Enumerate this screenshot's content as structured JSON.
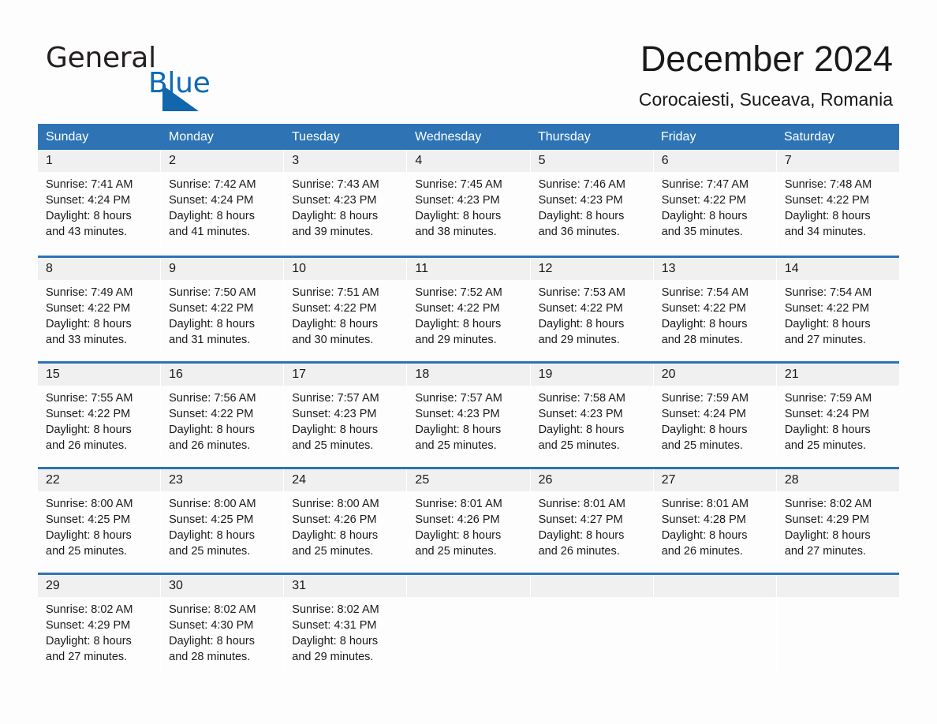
{
  "brand": {
    "word_one": "General",
    "word_two": "Blue",
    "logo_icon": "triangle-flag-icon"
  },
  "header": {
    "month_title": "December 2024",
    "location": "Corocaiesti, Suceava, Romania"
  },
  "colors": {
    "header_blue": "#2e74b5",
    "brand_blue": "#0d6ab5",
    "day_band_gray": "#f0f0f0",
    "page_bg": "#fdfdfd",
    "text": "#1a1a1a"
  },
  "calendar": {
    "weekday_headers": [
      "Sunday",
      "Monday",
      "Tuesday",
      "Wednesday",
      "Thursday",
      "Friday",
      "Saturday"
    ],
    "weeks": [
      [
        {
          "day": "1",
          "sunrise": "Sunrise: 7:41 AM",
          "sunset": "Sunset: 4:24 PM",
          "daylight_line1": "Daylight: 8 hours",
          "daylight_line2": "and 43 minutes."
        },
        {
          "day": "2",
          "sunrise": "Sunrise: 7:42 AM",
          "sunset": "Sunset: 4:24 PM",
          "daylight_line1": "Daylight: 8 hours",
          "daylight_line2": "and 41 minutes."
        },
        {
          "day": "3",
          "sunrise": "Sunrise: 7:43 AM",
          "sunset": "Sunset: 4:23 PM",
          "daylight_line1": "Daylight: 8 hours",
          "daylight_line2": "and 39 minutes."
        },
        {
          "day": "4",
          "sunrise": "Sunrise: 7:45 AM",
          "sunset": "Sunset: 4:23 PM",
          "daylight_line1": "Daylight: 8 hours",
          "daylight_line2": "and 38 minutes."
        },
        {
          "day": "5",
          "sunrise": "Sunrise: 7:46 AM",
          "sunset": "Sunset: 4:23 PM",
          "daylight_line1": "Daylight: 8 hours",
          "daylight_line2": "and 36 minutes."
        },
        {
          "day": "6",
          "sunrise": "Sunrise: 7:47 AM",
          "sunset": "Sunset: 4:22 PM",
          "daylight_line1": "Daylight: 8 hours",
          "daylight_line2": "and 35 minutes."
        },
        {
          "day": "7",
          "sunrise": "Sunrise: 7:48 AM",
          "sunset": "Sunset: 4:22 PM",
          "daylight_line1": "Daylight: 8 hours",
          "daylight_line2": "and 34 minutes."
        }
      ],
      [
        {
          "day": "8",
          "sunrise": "Sunrise: 7:49 AM",
          "sunset": "Sunset: 4:22 PM",
          "daylight_line1": "Daylight: 8 hours",
          "daylight_line2": "and 33 minutes."
        },
        {
          "day": "9",
          "sunrise": "Sunrise: 7:50 AM",
          "sunset": "Sunset: 4:22 PM",
          "daylight_line1": "Daylight: 8 hours",
          "daylight_line2": "and 31 minutes."
        },
        {
          "day": "10",
          "sunrise": "Sunrise: 7:51 AM",
          "sunset": "Sunset: 4:22 PM",
          "daylight_line1": "Daylight: 8 hours",
          "daylight_line2": "and 30 minutes."
        },
        {
          "day": "11",
          "sunrise": "Sunrise: 7:52 AM",
          "sunset": "Sunset: 4:22 PM",
          "daylight_line1": "Daylight: 8 hours",
          "daylight_line2": "and 29 minutes."
        },
        {
          "day": "12",
          "sunrise": "Sunrise: 7:53 AM",
          "sunset": "Sunset: 4:22 PM",
          "daylight_line1": "Daylight: 8 hours",
          "daylight_line2": "and 29 minutes."
        },
        {
          "day": "13",
          "sunrise": "Sunrise: 7:54 AM",
          "sunset": "Sunset: 4:22 PM",
          "daylight_line1": "Daylight: 8 hours",
          "daylight_line2": "and 28 minutes."
        },
        {
          "day": "14",
          "sunrise": "Sunrise: 7:54 AM",
          "sunset": "Sunset: 4:22 PM",
          "daylight_line1": "Daylight: 8 hours",
          "daylight_line2": "and 27 minutes."
        }
      ],
      [
        {
          "day": "15",
          "sunrise": "Sunrise: 7:55 AM",
          "sunset": "Sunset: 4:22 PM",
          "daylight_line1": "Daylight: 8 hours",
          "daylight_line2": "and 26 minutes."
        },
        {
          "day": "16",
          "sunrise": "Sunrise: 7:56 AM",
          "sunset": "Sunset: 4:22 PM",
          "daylight_line1": "Daylight: 8 hours",
          "daylight_line2": "and 26 minutes."
        },
        {
          "day": "17",
          "sunrise": "Sunrise: 7:57 AM",
          "sunset": "Sunset: 4:23 PM",
          "daylight_line1": "Daylight: 8 hours",
          "daylight_line2": "and 25 minutes."
        },
        {
          "day": "18",
          "sunrise": "Sunrise: 7:57 AM",
          "sunset": "Sunset: 4:23 PM",
          "daylight_line1": "Daylight: 8 hours",
          "daylight_line2": "and 25 minutes."
        },
        {
          "day": "19",
          "sunrise": "Sunrise: 7:58 AM",
          "sunset": "Sunset: 4:23 PM",
          "daylight_line1": "Daylight: 8 hours",
          "daylight_line2": "and 25 minutes."
        },
        {
          "day": "20",
          "sunrise": "Sunrise: 7:59 AM",
          "sunset": "Sunset: 4:24 PM",
          "daylight_line1": "Daylight: 8 hours",
          "daylight_line2": "and 25 minutes."
        },
        {
          "day": "21",
          "sunrise": "Sunrise: 7:59 AM",
          "sunset": "Sunset: 4:24 PM",
          "daylight_line1": "Daylight: 8 hours",
          "daylight_line2": "and 25 minutes."
        }
      ],
      [
        {
          "day": "22",
          "sunrise": "Sunrise: 8:00 AM",
          "sunset": "Sunset: 4:25 PM",
          "daylight_line1": "Daylight: 8 hours",
          "daylight_line2": "and 25 minutes."
        },
        {
          "day": "23",
          "sunrise": "Sunrise: 8:00 AM",
          "sunset": "Sunset: 4:25 PM",
          "daylight_line1": "Daylight: 8 hours",
          "daylight_line2": "and 25 minutes."
        },
        {
          "day": "24",
          "sunrise": "Sunrise: 8:00 AM",
          "sunset": "Sunset: 4:26 PM",
          "daylight_line1": "Daylight: 8 hours",
          "daylight_line2": "and 25 minutes."
        },
        {
          "day": "25",
          "sunrise": "Sunrise: 8:01 AM",
          "sunset": "Sunset: 4:26 PM",
          "daylight_line1": "Daylight: 8 hours",
          "daylight_line2": "and 25 minutes."
        },
        {
          "day": "26",
          "sunrise": "Sunrise: 8:01 AM",
          "sunset": "Sunset: 4:27 PM",
          "daylight_line1": "Daylight: 8 hours",
          "daylight_line2": "and 26 minutes."
        },
        {
          "day": "27",
          "sunrise": "Sunrise: 8:01 AM",
          "sunset": "Sunset: 4:28 PM",
          "daylight_line1": "Daylight: 8 hours",
          "daylight_line2": "and 26 minutes."
        },
        {
          "day": "28",
          "sunrise": "Sunrise: 8:02 AM",
          "sunset": "Sunset: 4:29 PM",
          "daylight_line1": "Daylight: 8 hours",
          "daylight_line2": "and 27 minutes."
        }
      ],
      [
        {
          "day": "29",
          "sunrise": "Sunrise: 8:02 AM",
          "sunset": "Sunset: 4:29 PM",
          "daylight_line1": "Daylight: 8 hours",
          "daylight_line2": "and 27 minutes."
        },
        {
          "day": "30",
          "sunrise": "Sunrise: 8:02 AM",
          "sunset": "Sunset: 4:30 PM",
          "daylight_line1": "Daylight: 8 hours",
          "daylight_line2": "and 28 minutes."
        },
        {
          "day": "31",
          "sunrise": "Sunrise: 8:02 AM",
          "sunset": "Sunset: 4:31 PM",
          "daylight_line1": "Daylight: 8 hours",
          "daylight_line2": "and 29 minutes."
        },
        {
          "day": "",
          "sunrise": "",
          "sunset": "",
          "daylight_line1": "",
          "daylight_line2": ""
        },
        {
          "day": "",
          "sunrise": "",
          "sunset": "",
          "daylight_line1": "",
          "daylight_line2": ""
        },
        {
          "day": "",
          "sunrise": "",
          "sunset": "",
          "daylight_line1": "",
          "daylight_line2": ""
        },
        {
          "day": "",
          "sunrise": "",
          "sunset": "",
          "daylight_line1": "",
          "daylight_line2": ""
        }
      ]
    ]
  }
}
